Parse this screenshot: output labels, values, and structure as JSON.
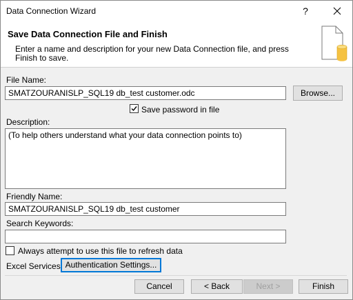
{
  "window": {
    "title": "Data Connection Wizard",
    "help_label": "?"
  },
  "header": {
    "title": "Save Data Connection File and Finish",
    "description": "Enter a name and description for your new Data Connection file, and press Finish to save."
  },
  "file_name": {
    "label": "File Name:",
    "value": "SMATZOURANISLP_SQL19 db_test customer.odc",
    "browse_label": "Browse..."
  },
  "save_password": {
    "label": "Save password in file",
    "checked": true
  },
  "description": {
    "label": "Description:",
    "placeholder": "(To help others understand what your data connection points to)"
  },
  "friendly_name": {
    "label": "Friendly Name:",
    "value": "SMATZOURANISLP_SQL19 db_test customer"
  },
  "search_keywords": {
    "label": "Search Keywords:",
    "value": ""
  },
  "always_refresh": {
    "label": "Always attempt to use this file to refresh data",
    "checked": false
  },
  "excel_services": {
    "label": "Excel Services:",
    "button_label": "Authentication Settings..."
  },
  "footer": {
    "cancel_label": "Cancel",
    "back_label": "< Back",
    "next_label": "Next >",
    "finish_label": "Finish"
  },
  "colors": {
    "focus": "#0078d7",
    "window_bg": "#f0f0f0",
    "header_bg": "#ffffff"
  }
}
